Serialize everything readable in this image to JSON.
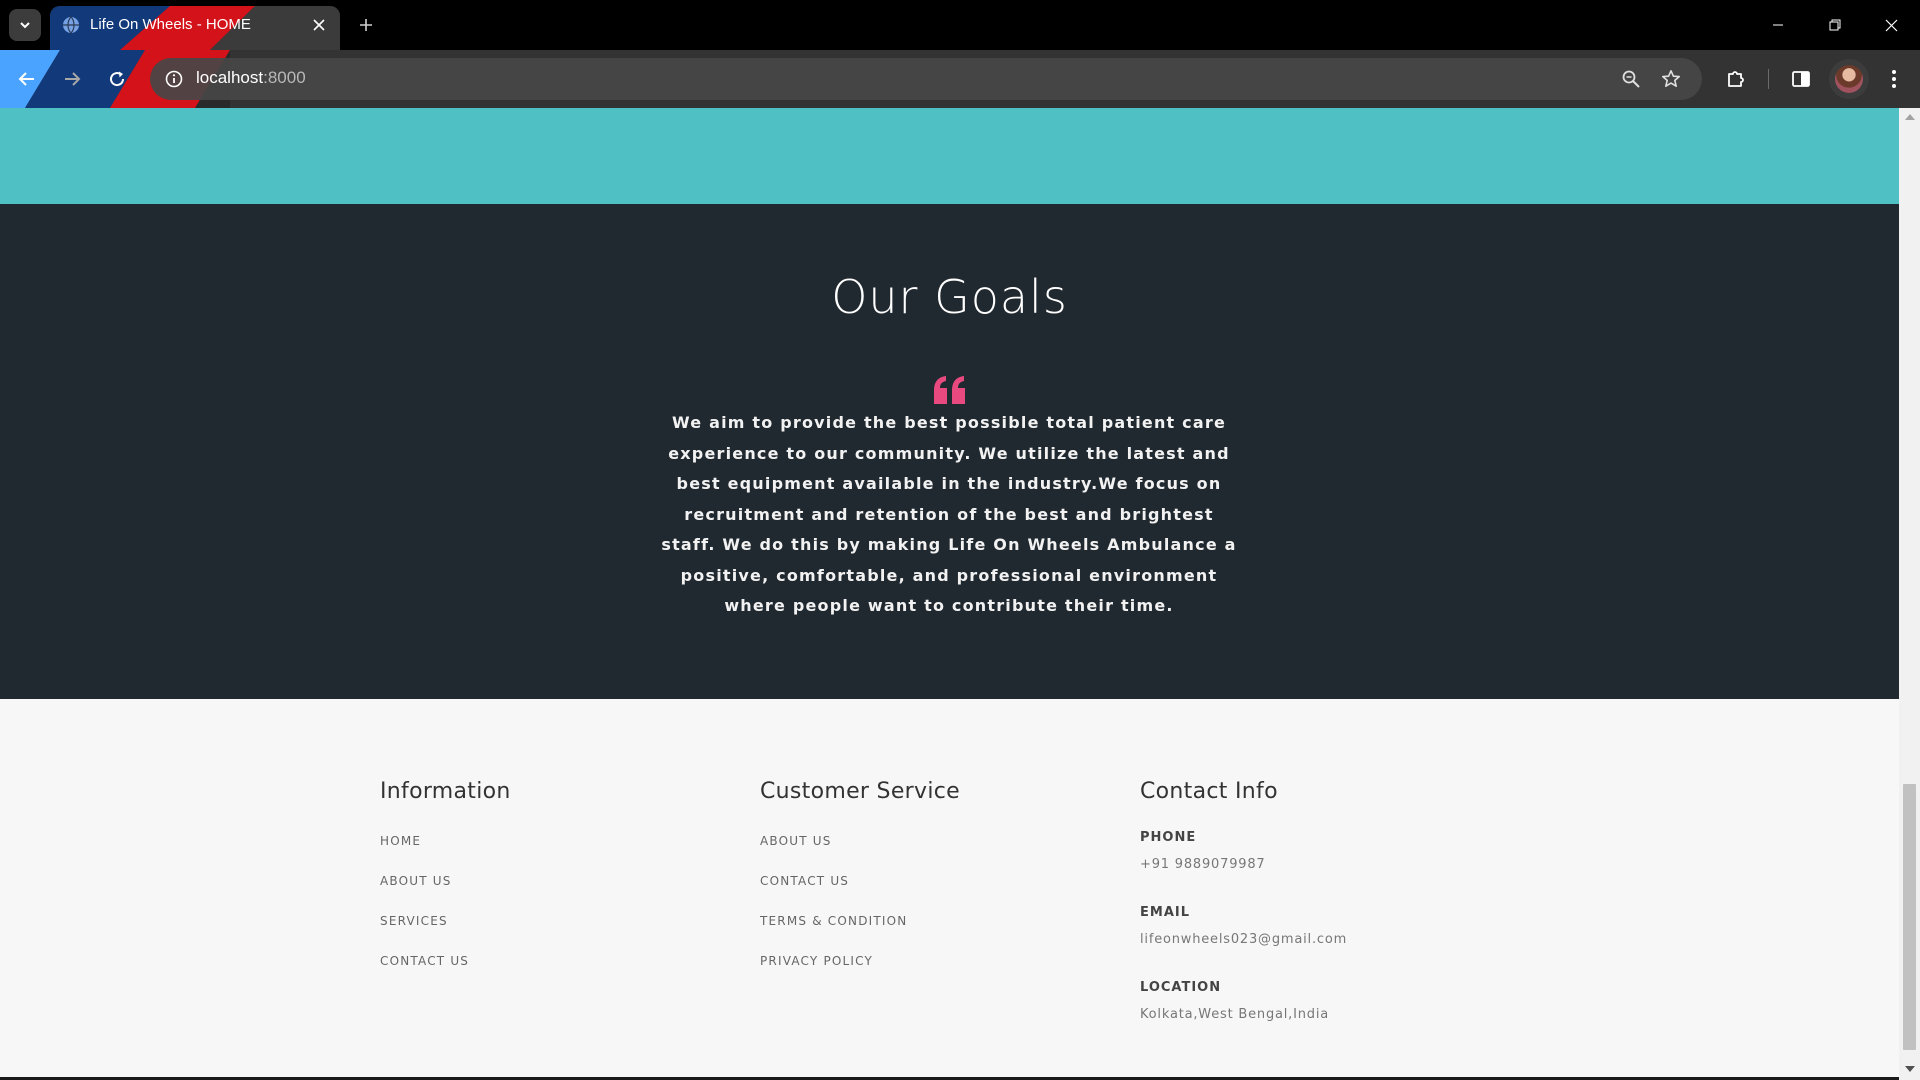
{
  "browser": {
    "tab_title": "Life On Wheels - HOME",
    "url_host": "localhost",
    "url_port": ":8000"
  },
  "goals": {
    "heading": "Our Goals",
    "text": "We aim to provide the best possible total patient care experience to our community. We utilize the latest and best equipment available in the industry.We focus on recruitment and retention of the best and brightest staff. We do this by making Life On Wheels Ambulance a positive, comfortable, and professional environment where people want to contribute their time."
  },
  "footer": {
    "information": {
      "heading": "Information",
      "links": [
        "HOME",
        "ABOUT US",
        "SERVICES",
        "CONTACT US"
      ]
    },
    "customer_service": {
      "heading": "Customer Service",
      "links": [
        "ABOUT US",
        "CONTACT US",
        "TERMS & CONDITION",
        "PRIVACY POLICY"
      ]
    },
    "contact": {
      "heading": "Contact Info",
      "phone_label": "PHONE",
      "phone": "+91 9889079987",
      "email_label": "EMAIL",
      "email": "lifeonwheels023@gmail.com",
      "location_label": "LOCATION",
      "location": "Kolkata,West Bengal,India"
    }
  },
  "colors": {
    "teal": "#4fc1c4",
    "goals_bg": "#212930",
    "quote_accent": "#e84a7f",
    "footer_bg": "#f7f7f7"
  },
  "icons": {
    "tab_search": "chevron-down-icon",
    "favicon": "globe-icon",
    "close": "close-icon",
    "new_tab": "plus-icon",
    "back": "arrow-left-icon",
    "forward": "arrow-right-icon",
    "reload": "reload-icon",
    "site_info": "info-icon",
    "zoom": "zoom-icon",
    "bookmark": "star-icon",
    "extensions": "puzzle-icon",
    "side_panel": "side-panel-icon",
    "menu": "kebab-menu-icon",
    "quote": "quote-icon"
  }
}
